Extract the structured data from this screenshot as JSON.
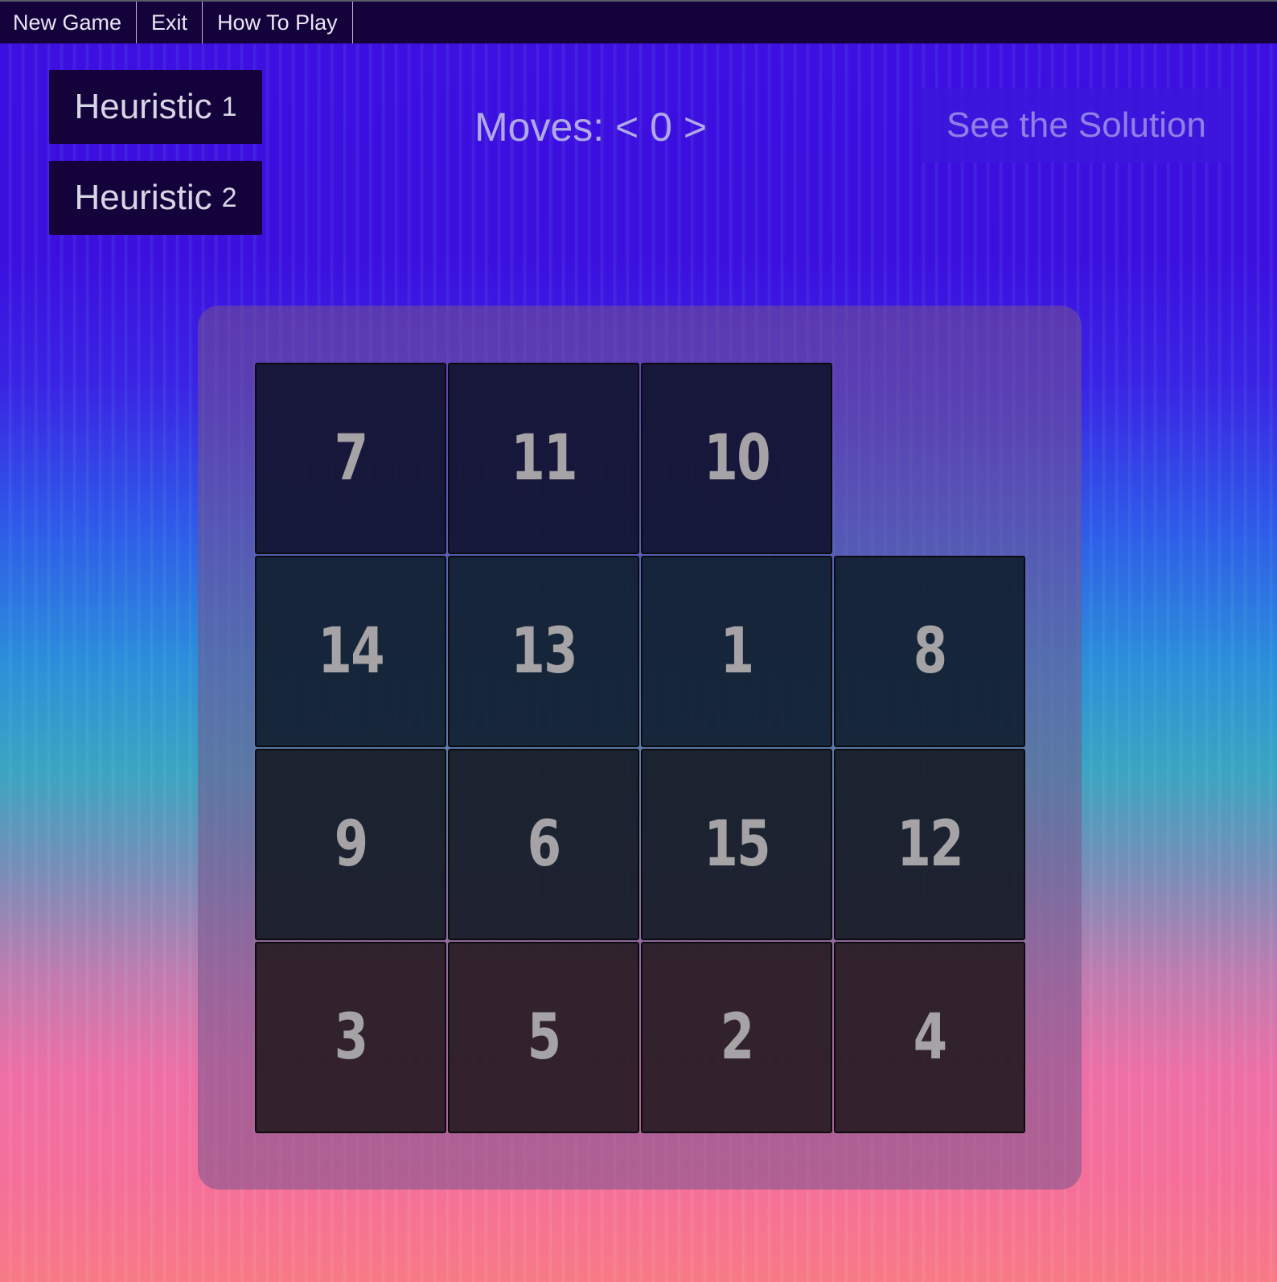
{
  "menu": {
    "items": [
      {
        "label": "New Game"
      },
      {
        "label": "Exit"
      },
      {
        "label": "How To Play"
      }
    ]
  },
  "heuristics": [
    {
      "label": "Heuristic",
      "num": "1"
    },
    {
      "label": "Heuristic",
      "num": "2"
    }
  ],
  "moves": {
    "text": "Moves: < 0 >"
  },
  "solution_button": {
    "label": "See the Solution"
  },
  "board": {
    "rows": [
      [
        "7",
        "11",
        "10",
        ""
      ],
      [
        "14",
        "13",
        "1",
        "8"
      ],
      [
        "9",
        "6",
        "15",
        "12"
      ],
      [
        "3",
        "5",
        "2",
        "4"
      ]
    ]
  },
  "colors": {
    "menu_bg": "#14033b",
    "moves_text": "#b1a9e6",
    "solution_text": "#8f80e6",
    "tile_text": "#a5a3a6"
  }
}
